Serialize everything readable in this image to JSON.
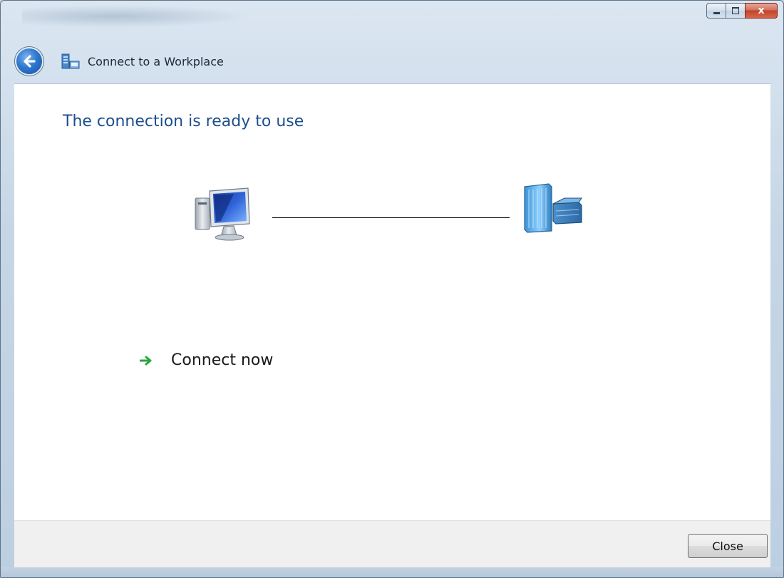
{
  "window": {
    "caption_buttons": {
      "close_glyph": "x"
    }
  },
  "nav": {
    "title": "Connect to a Workplace",
    "back_icon": "back-arrow-icon",
    "app_icon": "workplace-network-icon"
  },
  "main": {
    "heading": "The connection is ready to use",
    "diagram": {
      "left_icon": "computer-icon",
      "right_icon": "server-icon"
    },
    "action": {
      "label": "Connect now",
      "icon": "green-arrow-icon"
    }
  },
  "footer": {
    "close_label": "Close"
  },
  "colors": {
    "heading": "#1c4e8c",
    "link_arrow": "#2aa53a",
    "content_bg": "#ffffff",
    "footer_bg": "#f0f0f0"
  }
}
